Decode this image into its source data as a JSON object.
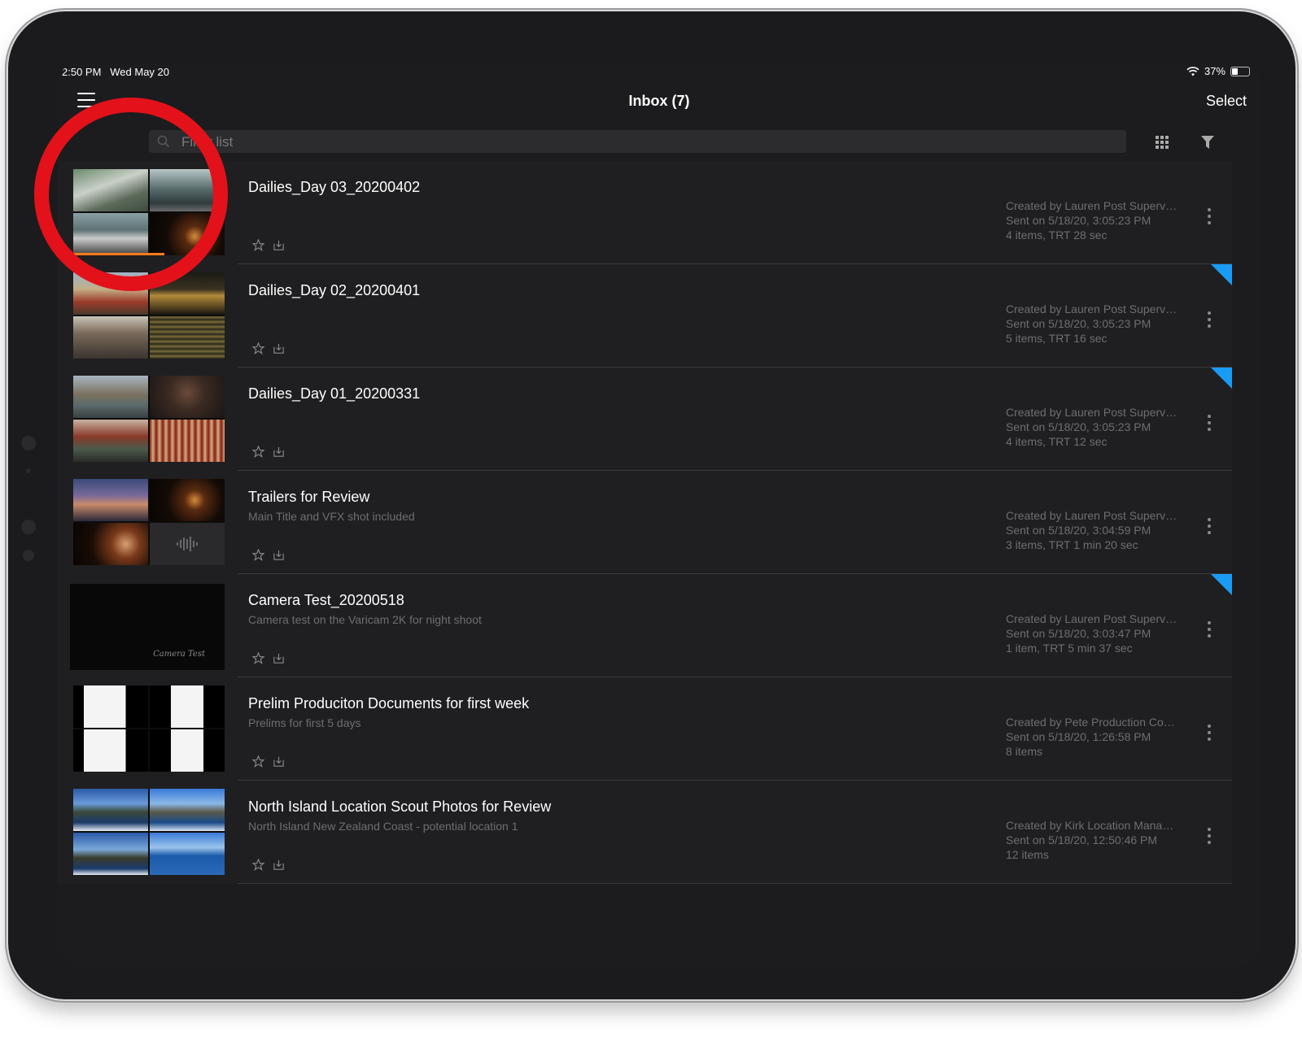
{
  "status": {
    "time": "2:50 PM",
    "date": "Wed May 20",
    "battery": "37%",
    "battery_level": 0.37
  },
  "nav": {
    "title": "Inbox (7)",
    "select_label": "Select"
  },
  "search": {
    "placeholder": "Filter list"
  },
  "icons": {
    "menu": "hamburger-menu-icon",
    "search": "search-icon",
    "grid": "grid-view-icon",
    "filter": "funnel-filter-icon",
    "star": "star-icon",
    "download": "download-icon",
    "more": "vertical-ellipsis-icon"
  },
  "colors": {
    "accent_blue": "#1a9bf5",
    "progress_orange": "#ff7a1a",
    "highlight_red": "#e3111a"
  },
  "items": [
    {
      "title": "Dailies_Day 03_20200402",
      "subtitle": "",
      "created": "Created by Lauren Post Superv…",
      "sent": "Sent on 5/18/20, 3:05:23 PM",
      "count": "4 items, TRT 28 sec",
      "unread": false,
      "progress": 0.6
    },
    {
      "title": "Dailies_Day 02_20200401",
      "subtitle": "",
      "created": "Created by Lauren Post Superv…",
      "sent": "Sent on 5/18/20, 3:05:23 PM",
      "count": "5 items, TRT 16 sec",
      "unread": true
    },
    {
      "title": "Dailies_Day 01_20200331",
      "subtitle": "",
      "created": "Created by Lauren Post Superv…",
      "sent": "Sent on 5/18/20, 3:05:23 PM",
      "count": "4 items, TRT 12 sec",
      "unread": true
    },
    {
      "title": "Trailers for Review",
      "subtitle": "Main Title and VFX shot included",
      "created": "Created by Lauren Post Superv…",
      "sent": "Sent on 5/18/20, 3:04:59 PM",
      "count": "3 items, TRT 1 min 20 sec",
      "unread": false
    },
    {
      "title": "Camera Test_20200518",
      "subtitle": "Camera test on the Varicam 2K for night shoot",
      "created": "Created by Lauren Post Superv…",
      "sent": "Sent on 5/18/20, 3:03:47 PM",
      "count": "1 item, TRT 5 min 37 sec",
      "unread": true,
      "thumb_caption": "Camera Test"
    },
    {
      "title": "Prelim Produciton Documents for first week",
      "subtitle": "Prelims for first 5 days",
      "created": "Created by Pete Production Co…",
      "sent": "Sent on 5/18/20, 1:26:58 PM",
      "count": "8 items",
      "unread": false
    },
    {
      "title": "North Island Location Scout Photos for Review",
      "subtitle": "North Island New Zealand Coast - potential location 1",
      "created": "Created by Kirk Location Mana…",
      "sent": "Sent on 5/18/20, 12:50:46 PM",
      "count": "12 items",
      "unread": false
    }
  ]
}
